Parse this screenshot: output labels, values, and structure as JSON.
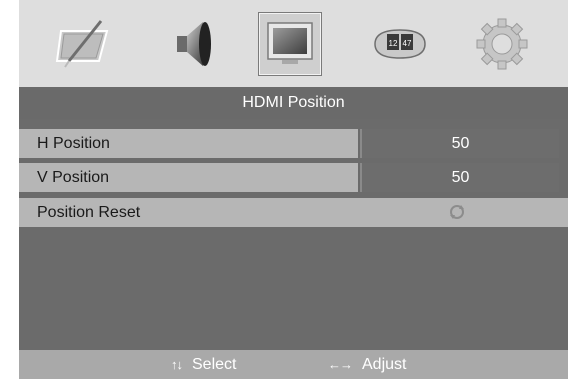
{
  "menu_icons": [
    {
      "name": "picture-icon",
      "selected": false
    },
    {
      "name": "speaker-icon",
      "selected": false
    },
    {
      "name": "screen-icon",
      "selected": true
    },
    {
      "name": "timer-icon",
      "selected": false,
      "clock_digits": [
        "12",
        "47"
      ]
    },
    {
      "name": "settings-gear-icon",
      "selected": false
    }
  ],
  "title": "HDMI Position",
  "items": [
    {
      "label": "H Position",
      "value": "50"
    },
    {
      "label": "V Position",
      "value": "50"
    },
    {
      "label": "Position Reset",
      "icon": "reset-icon"
    }
  ],
  "footer": {
    "select_arrows": "↑↓",
    "select_label": "Select",
    "adjust_arrows": "←→",
    "adjust_label": "Adjust"
  }
}
